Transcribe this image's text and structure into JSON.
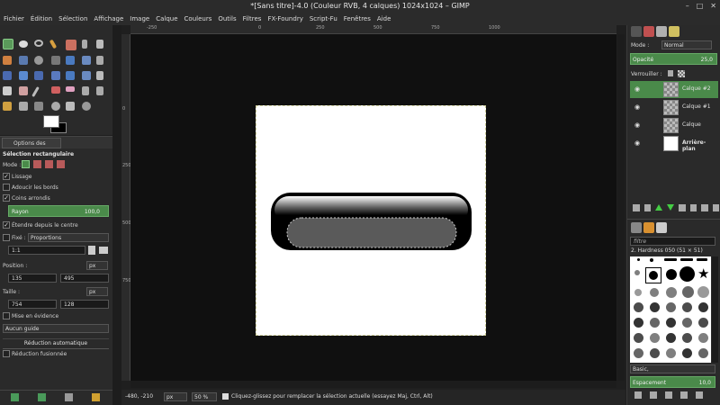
{
  "window": {
    "title": "*[Sans titre]-4.0 (Couleur RVB, 4 calques) 1024x1024 – GIMP",
    "controls": [
      "–",
      "□",
      "✕"
    ]
  },
  "menu": [
    "Fichier",
    "Édition",
    "Sélection",
    "Affichage",
    "Image",
    "Calque",
    "Couleurs",
    "Outils",
    "Filtres",
    "FX-Foundry",
    "Script-Fu",
    "Fenêtres",
    "Aide"
  ],
  "tool_options": {
    "tab": "Options des outils",
    "title": "Sélection rectangulaire",
    "mode_label": "Mode :",
    "lissage": "Lissage",
    "adoucir": "Adoucir les bords",
    "coins": "Coins arrondis",
    "rayon_label": "Rayon",
    "rayon_value": "100,0",
    "etendre": "Étendre depuis le centre",
    "fixe": "Fixé :",
    "fixe_option": "Proportions",
    "ratio": "1:1",
    "position_label": "Position :",
    "pos_x": "135",
    "pos_y": "495",
    "taille_label": "Taille :",
    "w": "754",
    "h": "128",
    "unit": "px",
    "mise": "Mise en évidence",
    "guide": "Aucun guide",
    "auto_title": "Réduction automatique",
    "fusion": "Réduction fusionnée"
  },
  "rulers": {
    "h": [
      "-250",
      "0",
      "250",
      "500",
      "750",
      "1000"
    ],
    "v": [
      "0",
      "250",
      "500",
      "750"
    ]
  },
  "status": {
    "coords": "-480, -210",
    "unit": "px",
    "zoom": "50 %",
    "message": "Cliquez-glissez pour remplacer la sélection actuelle (essayez Maj, Ctrl, Alt)"
  },
  "layers_panel": {
    "mode_label": "Mode :",
    "mode_value": "Normal",
    "opacity_label": "Opacité",
    "opacity_value": "25,0",
    "lock_label": "Verrouiller :",
    "layers": [
      {
        "name": "Calque #2"
      },
      {
        "name": "Calque #1"
      },
      {
        "name": "Calque"
      },
      {
        "name": "Arrière-plan"
      }
    ]
  },
  "brushes_panel": {
    "filter_label": "filtre",
    "brush_name": "2. Hardness 050 (51 × 51)",
    "preset": "Basic,",
    "spacing_label": "Espacement",
    "spacing_value": "10,0"
  },
  "colors": {
    "accent": "#4a8a4a",
    "canvas_bg": "#101010",
    "panel": "#2a2a2a"
  }
}
